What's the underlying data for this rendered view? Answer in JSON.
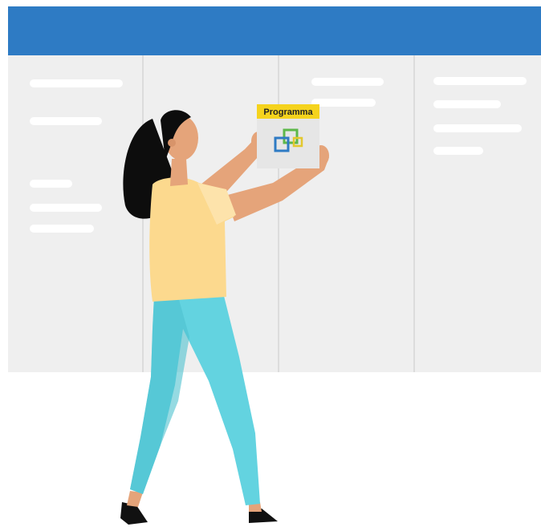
{
  "board": {
    "header_color": "#2e7bc4",
    "background_color": "#efefef",
    "column_count": 4
  },
  "card": {
    "label": "Programma",
    "label_band_color": "#f5d31d",
    "logo": "programma-logo-icon"
  },
  "person": {
    "shirt_color": "#fcd98e",
    "pants_color": "#63d3e0",
    "hair_color": "#0d0d0d",
    "skin_color": "#e5a47a"
  }
}
